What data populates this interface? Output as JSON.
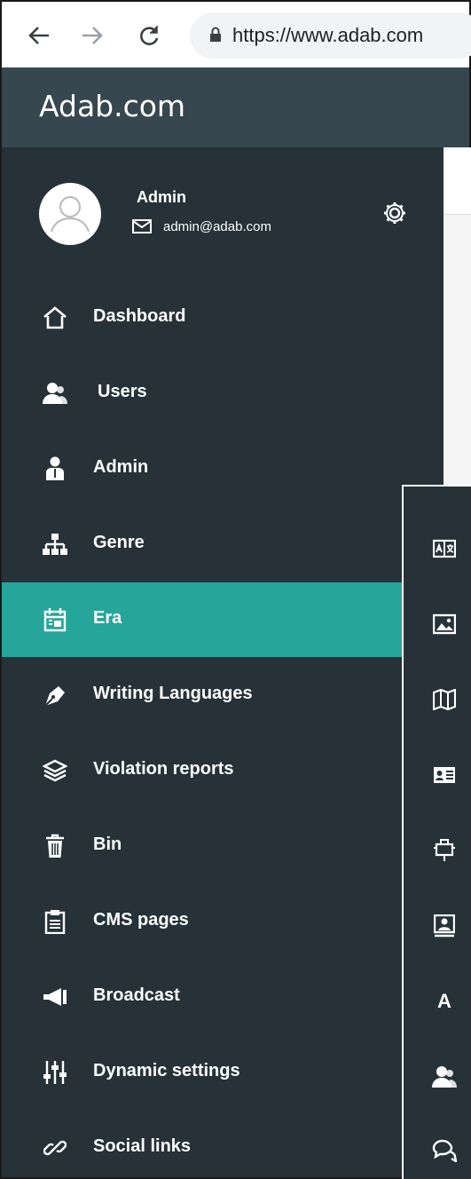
{
  "browser": {
    "url": "https://www.adab.com",
    "icons": [
      "back-arrow-icon",
      "forward-arrow-icon",
      "reload-icon",
      "lock-icon"
    ]
  },
  "app": {
    "title": "Adab.com"
  },
  "profile": {
    "name": "Admin",
    "email": "admin@adab.com"
  },
  "sidebar": {
    "items": [
      {
        "label": "Dashboard",
        "icon": "home-icon"
      },
      {
        "label": "Users",
        "icon": "users-icon"
      },
      {
        "label": "Admin",
        "icon": "admin-user-icon"
      },
      {
        "label": "Genre",
        "icon": "sitemap-icon"
      },
      {
        "label": "Era",
        "icon": "calendar-icon",
        "active": true
      },
      {
        "label": "Writing Languages",
        "icon": "pen-nib-icon"
      },
      {
        "label": "Violation reports",
        "icon": "layers-icon"
      },
      {
        "label": "Bin",
        "icon": "trash-icon"
      },
      {
        "label": "CMS pages",
        "icon": "clipboard-icon"
      },
      {
        "label": "Broadcast",
        "icon": "megaphone-icon"
      },
      {
        "label": "Dynamic settings",
        "icon": "sliders-icon"
      },
      {
        "label": "Social links",
        "icon": "link-icon"
      }
    ]
  },
  "overlay": {
    "icons": [
      "translate-icon",
      "image-icon",
      "map-icon",
      "id-card-icon",
      "mailbox-icon",
      "portrait-icon",
      "letter-a-icon",
      "users-icon",
      "comments-icon"
    ],
    "letter": "A"
  },
  "colors": {
    "header_bg": "#37474f",
    "sidebar_bg": "#263238",
    "active_bg": "#26a69a",
    "text": "#ffffff"
  }
}
